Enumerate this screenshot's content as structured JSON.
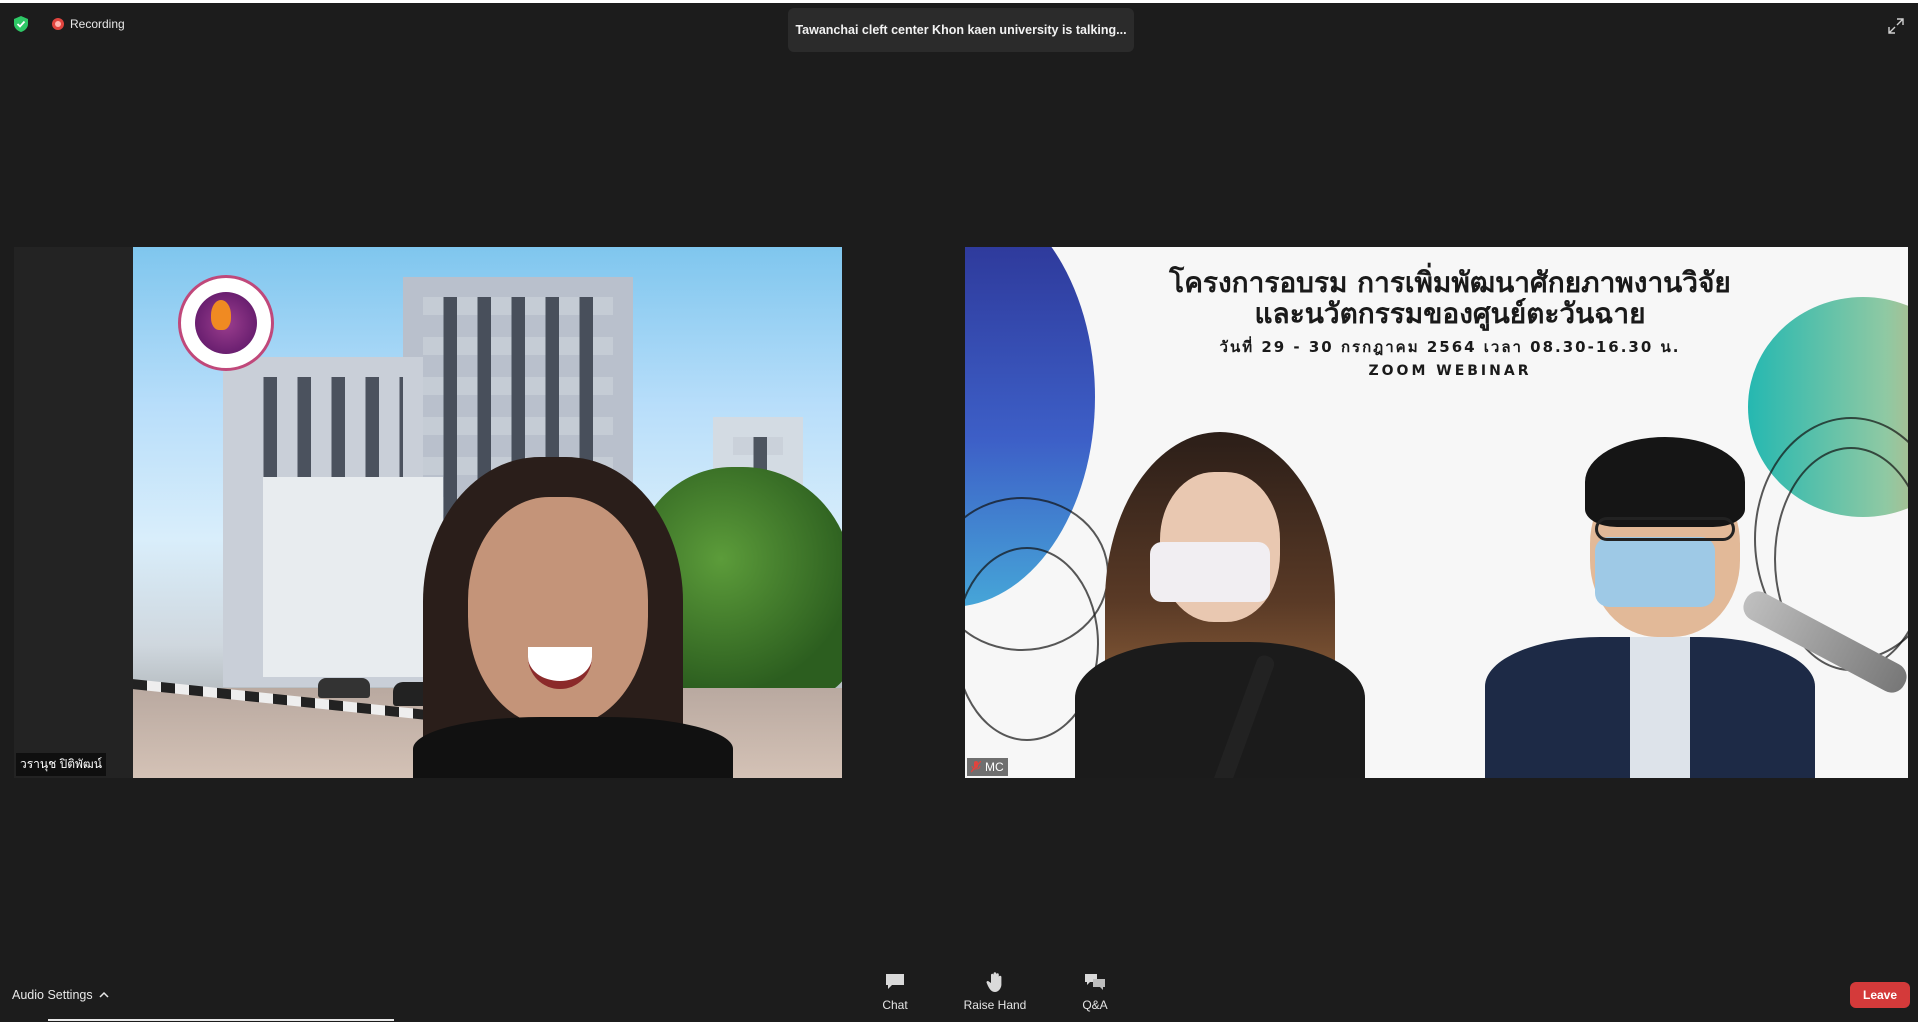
{
  "status": {
    "recording_label": "Recording",
    "talking_banner": "Tawanchai cleft center Khon kaen university is talking..."
  },
  "tiles": [
    {
      "name": "วรานุช ปิติพัฒน์"
    },
    {
      "name": "MC"
    }
  ],
  "slide": {
    "line1": "โครงการอบรม การเพิ่มพัฒนาศักยภาพงานวิจัย",
    "line2": "และนวัตกรรมของศูนย์ตะวันฉาย",
    "line3": "วันที่ 29 - 30 กรกฎาคม 2564 เวลา 08.30-16.30 น.",
    "line4": "ZOOM WEBINAR"
  },
  "bottom": {
    "audio_settings_label": "Audio Settings",
    "tools": [
      {
        "label": "Chat",
        "icon": "chat-icon"
      },
      {
        "label": "Raise Hand",
        "icon": "raise-hand-icon"
      },
      {
        "label": "Q&A",
        "icon": "qa-icon"
      }
    ],
    "leave_label": "Leave"
  },
  "colors": {
    "background": "#1c1c1c",
    "leave": "#d43a3a",
    "recording": "#e0443e",
    "secure": "#2ec866"
  }
}
